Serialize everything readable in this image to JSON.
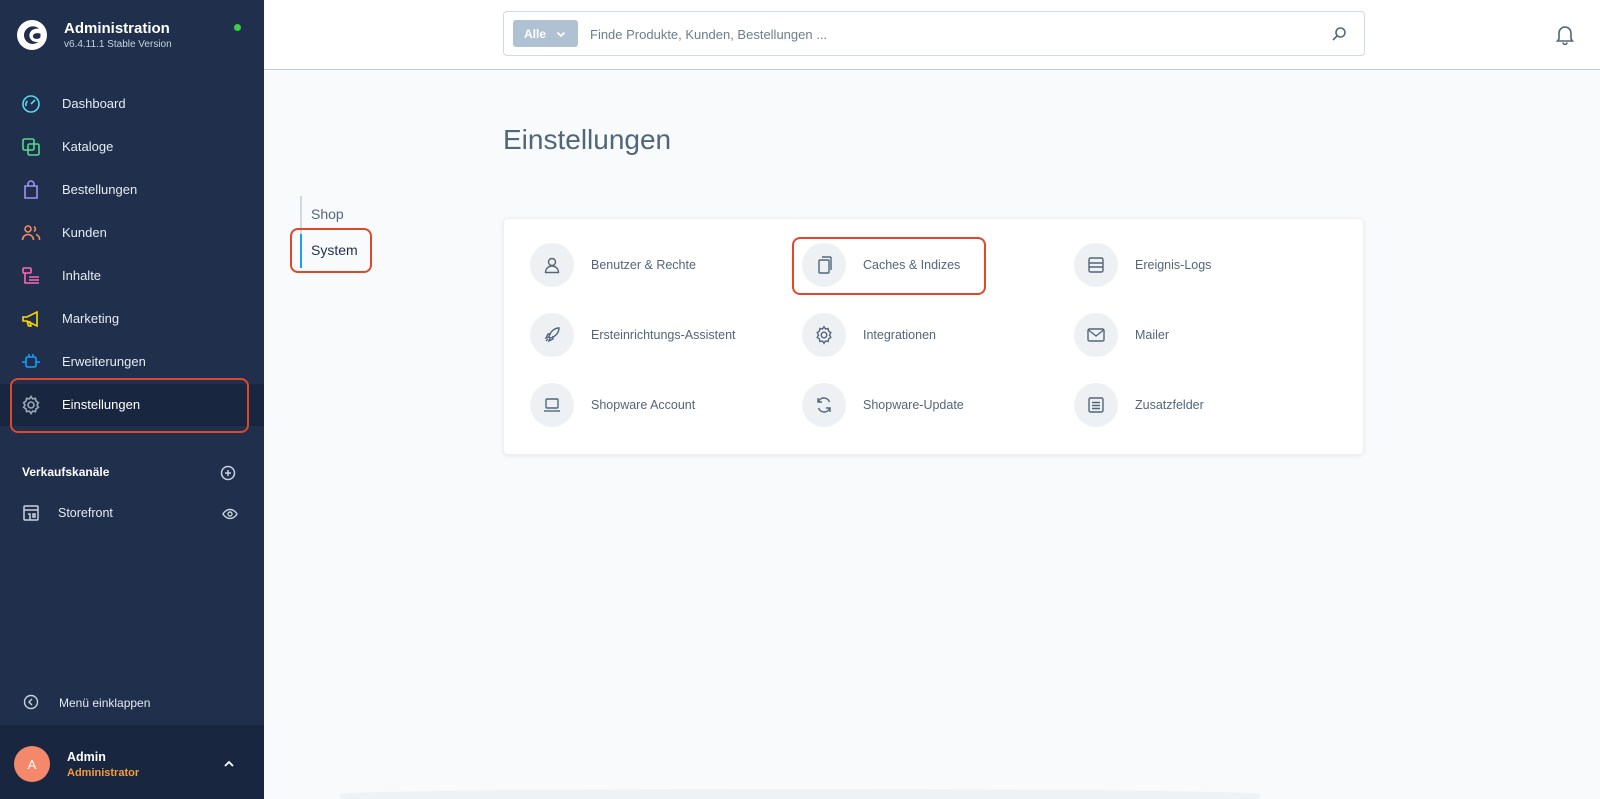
{
  "brand": {
    "title": "Administration",
    "version": "v6.4.11.1 Stable Version"
  },
  "nav": {
    "items": [
      {
        "label": "Dashboard",
        "icon": "dashboard-icon",
        "color": "#57d9f2"
      },
      {
        "label": "Kataloge",
        "icon": "catalog-icon",
        "color": "#57d98e"
      },
      {
        "label": "Bestellungen",
        "icon": "orders-icon",
        "color": "#a092f0"
      },
      {
        "label": "Kunden",
        "icon": "customers-icon",
        "color": "#f88962"
      },
      {
        "label": "Inhalte",
        "icon": "content-icon",
        "color": "#ff68b4"
      },
      {
        "label": "Marketing",
        "icon": "marketing-icon",
        "color": "#ffd700"
      },
      {
        "label": "Erweiterungen",
        "icon": "extensions-icon",
        "color": "#189eff"
      },
      {
        "label": "Einstellungen",
        "icon": "settings-icon",
        "color": "#9aa8b5"
      }
    ],
    "active": "Einstellungen"
  },
  "sales_channels": {
    "title": "Verkaufskanäle",
    "items": [
      {
        "label": "Storefront"
      }
    ]
  },
  "collapse_label": "Menü einklappen",
  "user": {
    "initial": "A",
    "name": "Admin",
    "role": "Administrator"
  },
  "search": {
    "type_label": "Alle",
    "placeholder": "Finde Produkte, Kunden, Bestellungen ..."
  },
  "page": {
    "title": "Einstellungen",
    "tabs": [
      {
        "label": "Shop"
      },
      {
        "label": "System"
      }
    ],
    "active_tab": "System"
  },
  "settings": {
    "tiles": [
      {
        "label": "Benutzer & Rechte",
        "icon": "user-icon"
      },
      {
        "label": "Caches & Indizes",
        "icon": "cache-icon"
      },
      {
        "label": "Ereignis-Logs",
        "icon": "log-icon"
      },
      {
        "label": "Ersteinrichtungs-Assistent",
        "icon": "rocket-icon"
      },
      {
        "label": "Integrationen",
        "icon": "cog-icon"
      },
      {
        "label": "Mailer",
        "icon": "envelope-icon"
      },
      {
        "label": "Shopware Account",
        "icon": "laptop-icon"
      },
      {
        "label": "Shopware-Update",
        "icon": "refresh-icon"
      },
      {
        "label": "Zusatzfelder",
        "icon": "list-icon"
      }
    ]
  },
  "colors": {
    "sidebar_bg": "#1f2f4c",
    "highlight": "#e0482a",
    "status_online": "#37d046",
    "accent": "#189eff"
  }
}
